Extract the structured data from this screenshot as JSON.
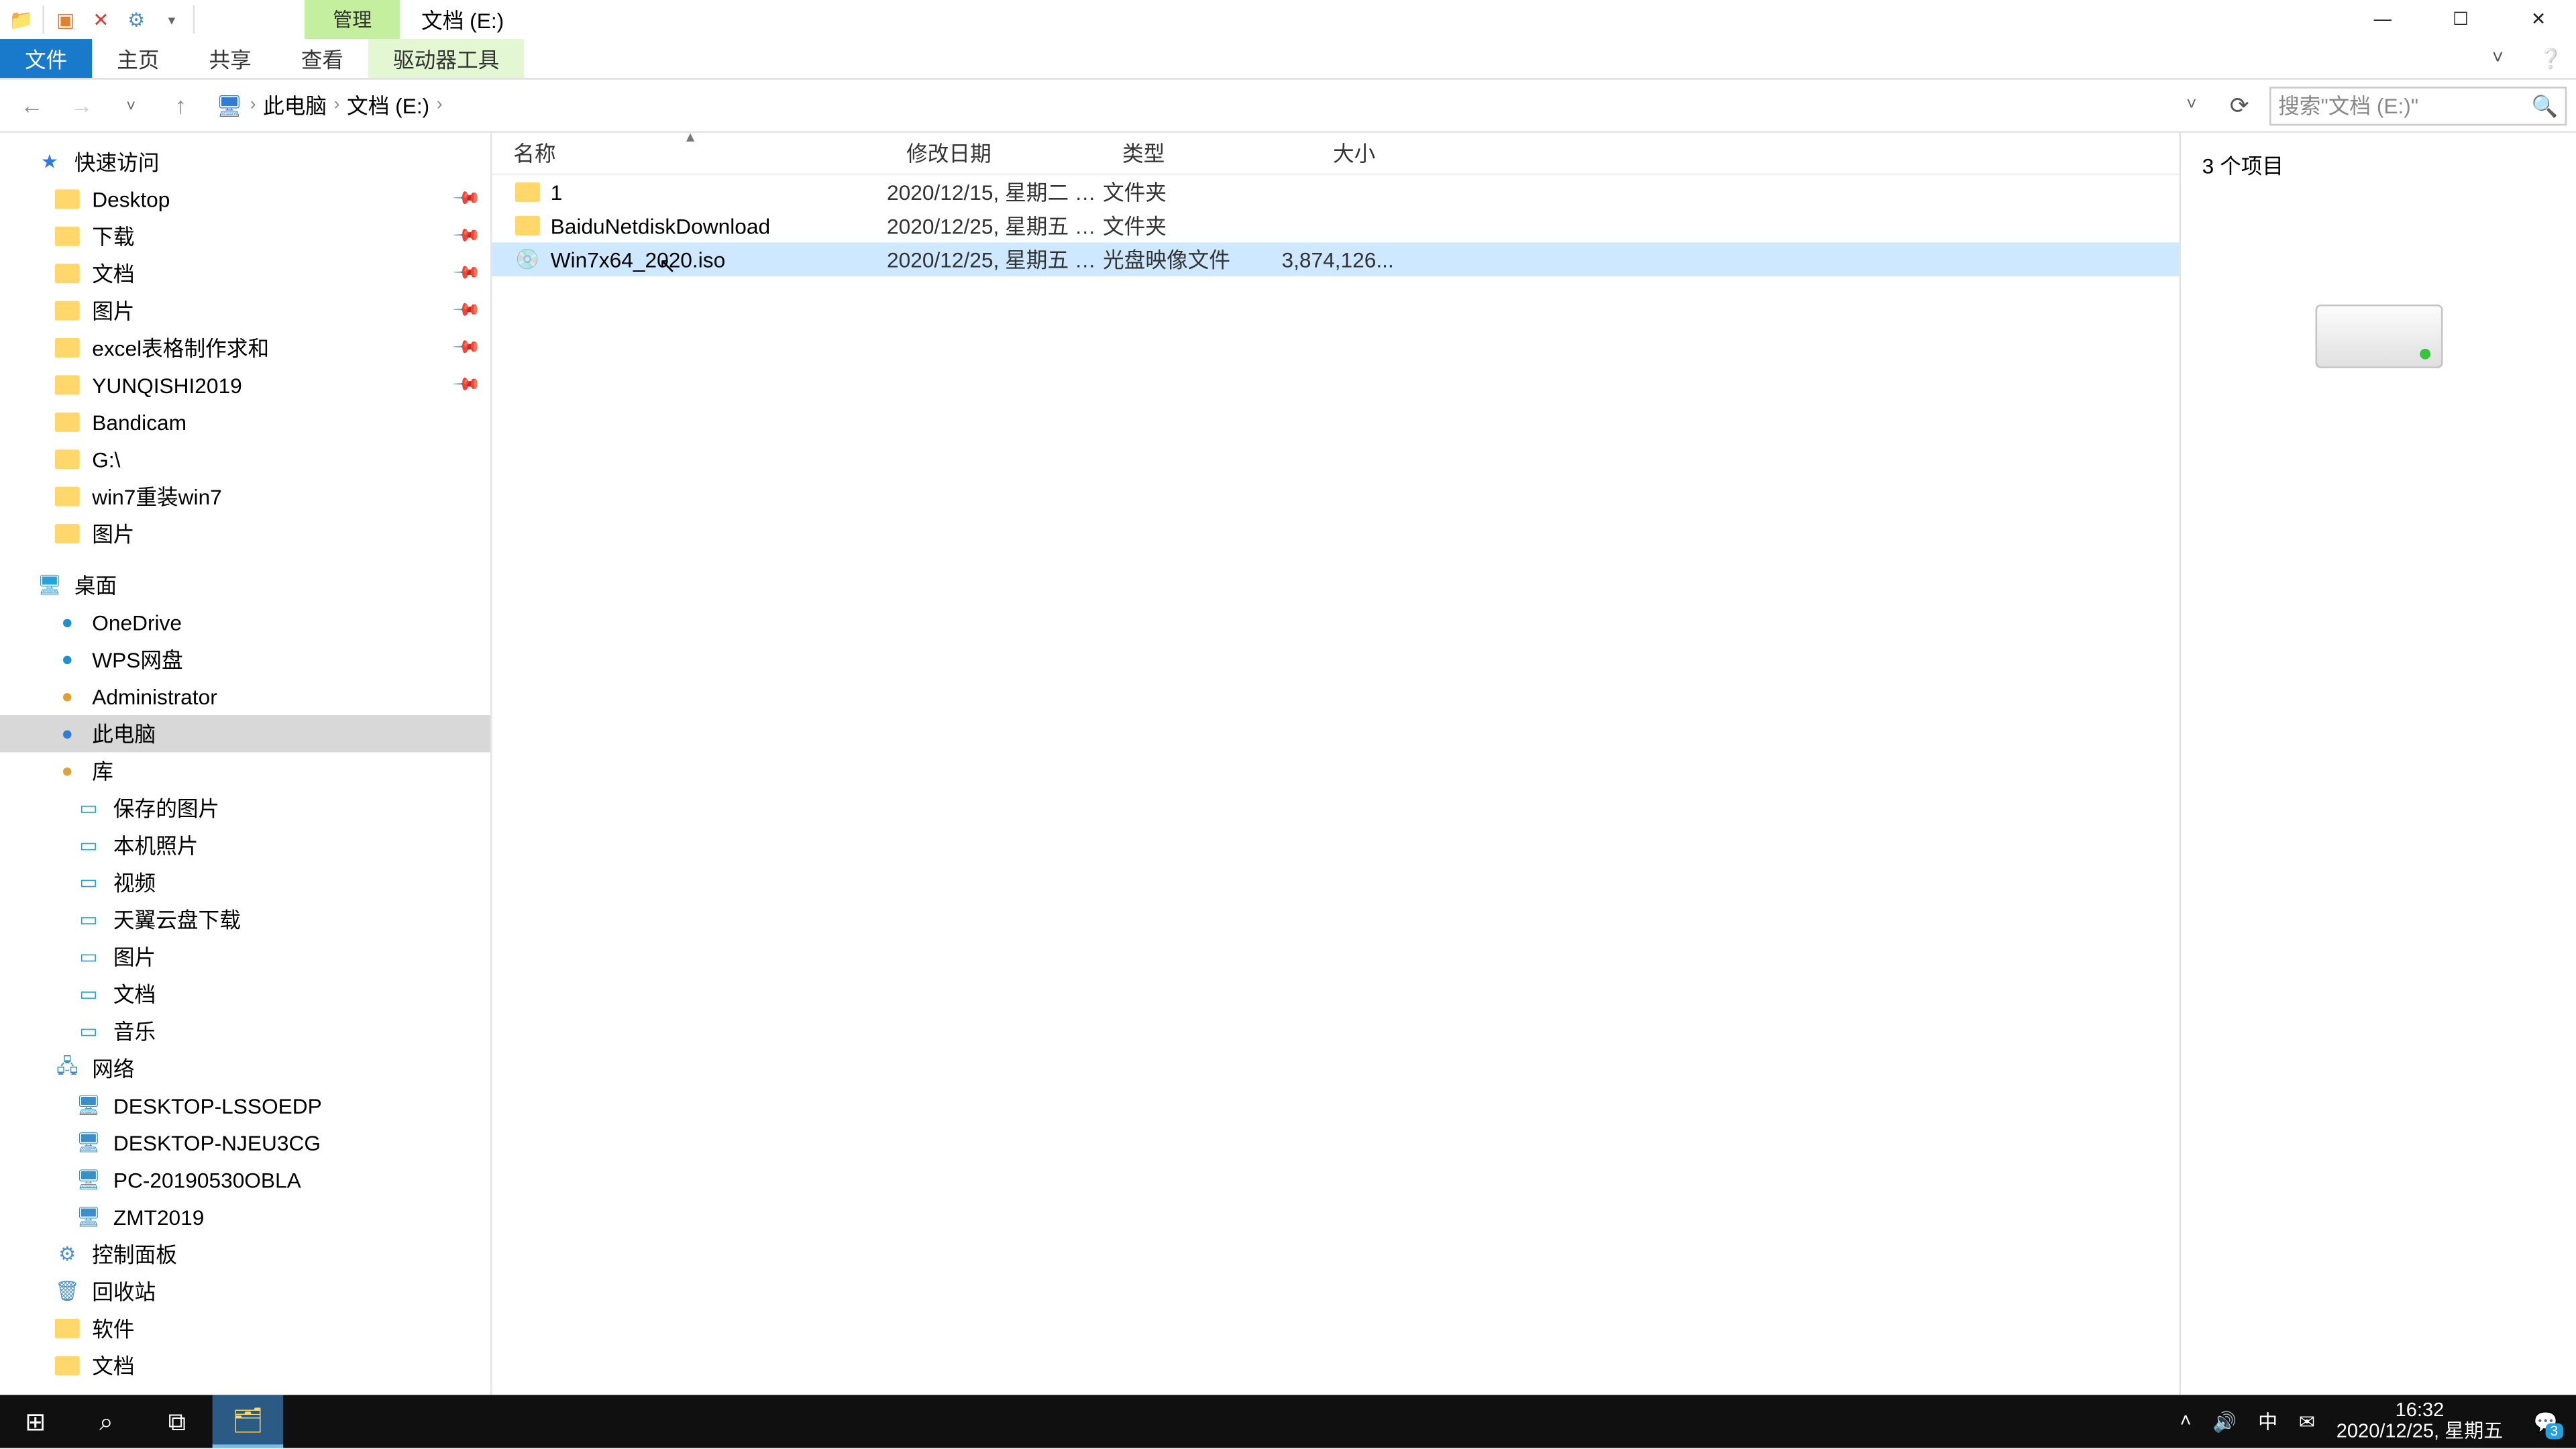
{
  "titlebar": {
    "contextual_tab": "管理",
    "window_title": "文档 (E:)"
  },
  "ribbon": {
    "file": "文件",
    "home": "主页",
    "share": "共享",
    "view": "查看",
    "drivetools": "驱动器工具"
  },
  "nav": {
    "back": "←",
    "forward": "→",
    "up": "↑",
    "refresh": "⟳"
  },
  "breadcrumb": {
    "root": "此电脑",
    "drive": "文档 (E:)"
  },
  "search": {
    "placeholder": "搜索\"文档 (E:)\""
  },
  "tree": {
    "quick": "快速访问",
    "quick_items": [
      {
        "label": "Desktop",
        "pin": true
      },
      {
        "label": "下载",
        "pin": true
      },
      {
        "label": "文档",
        "pin": true
      },
      {
        "label": "图片",
        "pin": true
      },
      {
        "label": "excel表格制作求和",
        "pin": true
      },
      {
        "label": "YUNQISHI2019",
        "pin": true
      },
      {
        "label": "Bandicam"
      },
      {
        "label": "G:\\"
      },
      {
        "label": "win7重装win7"
      },
      {
        "label": "图片"
      }
    ],
    "desktop": "桌面",
    "desktop_items": [
      {
        "label": "OneDrive",
        "cls": "ic-onedrive"
      },
      {
        "label": "WPS网盘",
        "cls": "ic-wps"
      },
      {
        "label": "Administrator",
        "cls": "ic-admin"
      },
      {
        "label": "此电脑",
        "cls": "ic-thispc",
        "sel": true
      },
      {
        "label": "库",
        "cls": "ic-lib"
      }
    ],
    "lib_items": [
      {
        "label": "保存的图片",
        "cls": "ic-pic"
      },
      {
        "label": "本机照片",
        "cls": "ic-pic"
      },
      {
        "label": "视频",
        "cls": "ic-pic"
      },
      {
        "label": "天翼云盘下载",
        "cls": "ic-pic"
      },
      {
        "label": "图片",
        "cls": "ic-pic"
      },
      {
        "label": "文档",
        "cls": "ic-pic"
      },
      {
        "label": "音乐",
        "cls": "ic-pic"
      }
    ],
    "network": "网络",
    "net_items": [
      {
        "label": "DESKTOP-LSSOEDP"
      },
      {
        "label": "DESKTOP-NJEU3CG"
      },
      {
        "label": "PC-20190530OBLA"
      },
      {
        "label": "ZMT2019"
      }
    ],
    "cpl": "控制面板",
    "recycle": "回收站",
    "soft": "软件",
    "wendang": "文档"
  },
  "columns": {
    "name": "名称",
    "date": "修改日期",
    "type": "类型",
    "size": "大小"
  },
  "files": [
    {
      "name": "1",
      "date": "2020/12/15, 星期二 1...",
      "type": "文件夹",
      "size": "",
      "icon": "folder"
    },
    {
      "name": "BaiduNetdiskDownload",
      "date": "2020/12/25, 星期五 1...",
      "type": "文件夹",
      "size": "",
      "icon": "folder"
    },
    {
      "name": "Win7x64_2020.iso",
      "date": "2020/12/25, 星期五 1...",
      "type": "光盘映像文件",
      "size": "3,874,126...",
      "icon": "disc",
      "selected": true
    }
  ],
  "preview": {
    "count": "3 个项目"
  },
  "status": {
    "text": "3 个项目"
  },
  "tray": {
    "ime": "中",
    "time": "16:32",
    "date": "2020/12/25, 星期五",
    "notif_count": "3"
  }
}
